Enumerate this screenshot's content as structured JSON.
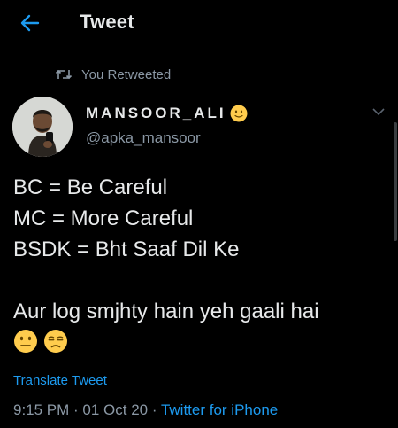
{
  "header": {
    "back_icon": "arrow-left-icon",
    "title": "Tweet"
  },
  "social_context": {
    "icon": "retweet-icon",
    "text": "You Retweeted"
  },
  "author": {
    "display_name": "MANSOOR_ALI",
    "name_emoji": "slightly-smiling-face",
    "handle": "@apka_mansoor"
  },
  "tweet": {
    "lines": [
      "BC = Be Careful",
      "MC = More Careful",
      "BSDK = Bht Saaf Dil Ke"
    ],
    "closing_line": "Aur log smjhty hain yeh gaali hai",
    "emojis": [
      "neutral-face",
      "unamused-face"
    ]
  },
  "translate_label": "Translate Tweet",
  "meta": {
    "time": "9:15 PM",
    "separator": " · ",
    "date": "01 Oct 20",
    "source": "Twitter for iPhone"
  },
  "colors": {
    "background": "#000000",
    "accent": "#1d9bf0",
    "secondary_text": "#8b98a5",
    "primary_text": "#e7e9ea",
    "divider": "#2f3336"
  }
}
